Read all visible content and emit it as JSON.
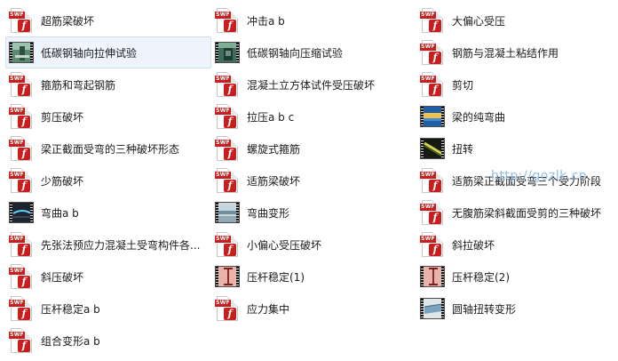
{
  "columns": [
    {
      "items": [
        {
          "label": "超筋梁破坏",
          "icon": "swf-file-icon",
          "type": "swf"
        },
        {
          "label": "低碳钢轴向拉伸试验",
          "icon": "video-file-icon",
          "type": "video",
          "scene": "lab-tensile",
          "selected": true
        },
        {
          "label": "箍筋和弯起钢筋",
          "icon": "swf-file-icon",
          "type": "swf"
        },
        {
          "label": "剪压破坏",
          "icon": "swf-file-icon",
          "type": "swf"
        },
        {
          "label": "梁正截面受弯的三种破坏形态",
          "icon": "swf-file-icon",
          "type": "swf"
        },
        {
          "label": "少筋破坏",
          "icon": "swf-file-icon",
          "type": "swf"
        },
        {
          "label": "弯曲a  b",
          "icon": "video-file-icon",
          "type": "video",
          "scene": "bending-dark"
        },
        {
          "label": "先张法预应力混凝土受弯构件各...",
          "icon": "swf-file-icon",
          "type": "swf"
        },
        {
          "label": "斜压破坏",
          "icon": "swf-file-icon",
          "type": "swf"
        },
        {
          "label": "压杆稳定a  b",
          "icon": "swf-file-icon",
          "type": "swf"
        },
        {
          "label": "组合变形a  b",
          "icon": "swf-file-icon",
          "type": "swf"
        }
      ]
    },
    {
      "items": [
        {
          "label": "冲击a b",
          "icon": "swf-file-icon",
          "type": "swf"
        },
        {
          "label": "低碳钢轴向压缩试验",
          "icon": "video-file-icon",
          "type": "video",
          "scene": "lab-compress"
        },
        {
          "label": "混凝土立方体试件受压破坏",
          "icon": "swf-file-icon",
          "type": "swf"
        },
        {
          "label": "拉压a  b  c",
          "icon": "swf-file-icon",
          "type": "swf"
        },
        {
          "label": "螺旋式箍筋",
          "icon": "swf-file-icon",
          "type": "swf"
        },
        {
          "label": "适筋梁破坏",
          "icon": "swf-file-icon",
          "type": "swf"
        },
        {
          "label": "弯曲变形",
          "icon": "video-file-icon",
          "type": "video",
          "scene": "bending-light"
        },
        {
          "label": "小偏心受压破坏",
          "icon": "swf-file-icon",
          "type": "swf"
        },
        {
          "label": "压杆稳定(1)",
          "icon": "video-file-icon",
          "type": "video",
          "scene": "column-pink"
        },
        {
          "label": "应力集中",
          "icon": "swf-file-icon",
          "type": "swf"
        }
      ]
    },
    {
      "items": [
        {
          "label": "大偏心受压",
          "icon": "swf-file-icon",
          "type": "swf"
        },
        {
          "label": "钢筋与混凝土粘结作用",
          "icon": "swf-file-icon",
          "type": "swf"
        },
        {
          "label": "剪切",
          "icon": "swf-file-icon",
          "type": "swf"
        },
        {
          "label": "梁的纯弯曲",
          "icon": "video-file-icon",
          "type": "video",
          "scene": "beam-blue"
        },
        {
          "label": "扭转",
          "icon": "video-file-icon",
          "type": "video",
          "scene": "torsion-dark"
        },
        {
          "label": "适筋梁正截面受弯三个受力阶段",
          "icon": "swf-file-icon",
          "type": "swf"
        },
        {
          "label": "无腹筋梁斜截面受剪的三种破坏",
          "icon": "swf-file-icon",
          "type": "swf"
        },
        {
          "label": "斜拉破坏",
          "icon": "swf-file-icon",
          "type": "swf"
        },
        {
          "label": "压杆稳定(2)",
          "icon": "video-file-icon",
          "type": "video",
          "scene": "column-pink"
        },
        {
          "label": "圆轴扭转变形",
          "icon": "video-file-icon",
          "type": "video",
          "scene": "shaft-light"
        }
      ]
    }
  ],
  "swf_badge_text": "SWF",
  "watermark": "http://gozlk.cn"
}
